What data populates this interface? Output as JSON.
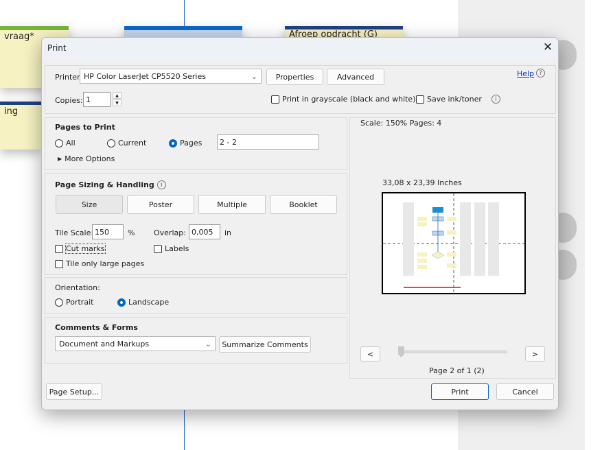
{
  "background": {
    "note1": "vraag*",
    "note2": "Afroep opdracht (G)",
    "note3": "ing"
  },
  "dialog": {
    "title": "Print",
    "printer": {
      "label": "Printer:",
      "value": "HP Color LaserJet CP5520 Series",
      "properties": "Properties",
      "advanced": "Advanced",
      "help": "Help"
    },
    "copies": {
      "label": "Copies:",
      "value": "1"
    },
    "grayscale": {
      "label": "Print in grayscale (black and white)",
      "checked": false
    },
    "save_ink": {
      "label": "Save ink/toner",
      "checked": false
    },
    "pages_to_print": {
      "title": "Pages to Print",
      "all": "All",
      "current": "Current",
      "pages": "Pages",
      "selected": "Pages",
      "range": "2 - 2",
      "more_options": "More Options"
    },
    "sizing": {
      "title": "Page Sizing & Handling",
      "buttons": [
        "Size",
        "Poster",
        "Multiple",
        "Booklet"
      ],
      "selected": "Poster",
      "tile_scale_label": "Tile Scale:",
      "tile_scale": "150",
      "percent": "%",
      "overlap_label": "Overlap:",
      "overlap": "0,005",
      "unit": "in",
      "cut_marks": "Cut marks",
      "labels": "Labels",
      "tile_large": "Tile only large pages"
    },
    "orientation": {
      "title": "Orientation:",
      "portrait": "Portrait",
      "landscape": "Landscape",
      "selected": "Landscape"
    },
    "comments": {
      "title": "Comments & Forms",
      "value": "Document and Markups",
      "summarize": "Summarize Comments"
    },
    "preview": {
      "scale": "Scale: 150% Pages: 4",
      "size": "33,08 x 23,39 Inches",
      "prev": "<",
      "next": ">",
      "page": "Page 2 of 1 (2)"
    },
    "footer": {
      "page_setup": "Page Setup...",
      "print": "Print",
      "cancel": "Cancel"
    },
    "colors": {
      "accent": "#0067c0"
    }
  }
}
